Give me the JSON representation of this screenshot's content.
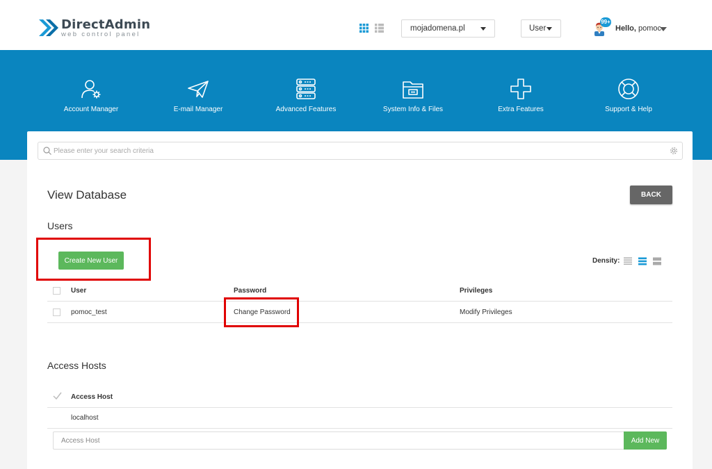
{
  "header": {
    "logo_title": "DirectAdmin",
    "logo_subtitle": "web control panel",
    "domain_selector": "mojadomena.pl",
    "role_selector": "User",
    "notification_count": "99+",
    "greeting_prefix": "Hello,",
    "username": "pomoc"
  },
  "nav": [
    {
      "label": "Account Manager",
      "icon": "account-manager-icon"
    },
    {
      "label": "E-mail Manager",
      "icon": "paper-plane-icon"
    },
    {
      "label": "Advanced Features",
      "icon": "server-icon"
    },
    {
      "label": "System Info & Files",
      "icon": "folder-icon"
    },
    {
      "label": "Extra Features",
      "icon": "plus-icon"
    },
    {
      "label": "Support & Help",
      "icon": "lifebuoy-icon"
    }
  ],
  "search": {
    "placeholder": "Please enter your search criteria"
  },
  "page": {
    "title": "View Database",
    "back_label": "BACK"
  },
  "users": {
    "section_title": "Users",
    "create_label": "Create New User",
    "density_label": "Density:",
    "columns": [
      "User",
      "Password",
      "Privileges"
    ],
    "rows": [
      {
        "user": "pomoc_test",
        "password": "Change Password",
        "privileges": "Modify Privileges"
      }
    ]
  },
  "access_hosts": {
    "section_title": "Access Hosts",
    "column": "Access Host",
    "rows": [
      "localhost"
    ],
    "input_placeholder": "Access Host",
    "add_label": "Add New"
  },
  "colors": {
    "brand_blue": "#0a85bf",
    "success_green": "#5cb85c",
    "back_gray": "#666666",
    "highlight_red": "#e00000"
  }
}
